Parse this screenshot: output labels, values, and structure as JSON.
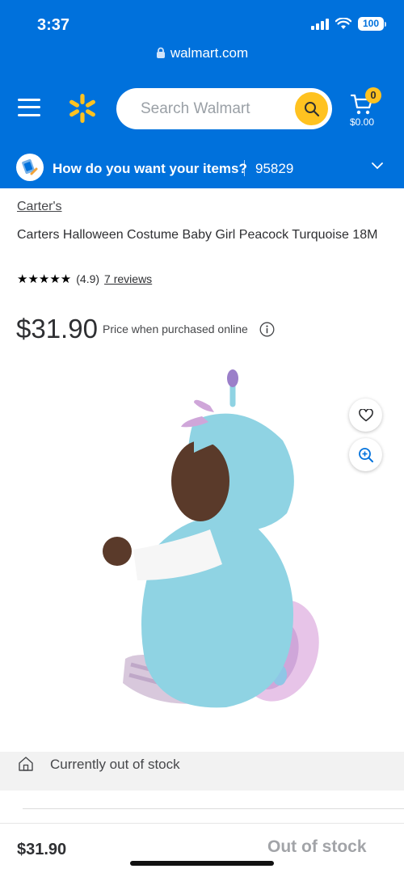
{
  "status_bar": {
    "time": "3:37",
    "battery": "100"
  },
  "browser": {
    "url": "walmart.com"
  },
  "header": {
    "search_placeholder": "Search Walmart",
    "cart_count": "0",
    "cart_total": "$0.00"
  },
  "fulfillment": {
    "question": "How do you want your items?",
    "zip": "95829"
  },
  "product": {
    "brand": "Carter's",
    "title": "Carters Halloween Costume Baby Girl Peacock Turquoise 18M",
    "rating_value": "(4.9)",
    "reviews_label": "7 reviews",
    "price": "$31.90",
    "price_note": "Price when purchased online"
  },
  "stock": {
    "status": "Currently out of stock"
  },
  "bottom_bar": {
    "price": "$31.90",
    "status": "Out of stock"
  },
  "icons": [
    "hamburger-menu-icon",
    "walmart-spark-icon",
    "search-icon",
    "cart-icon",
    "delivery-icon",
    "chevron-down-icon",
    "info-icon",
    "heart-icon",
    "zoom-in-icon",
    "store-icon",
    "lock-icon"
  ],
  "colors": {
    "brand_blue": "#0071dc",
    "spark_yellow": "#ffc220"
  }
}
